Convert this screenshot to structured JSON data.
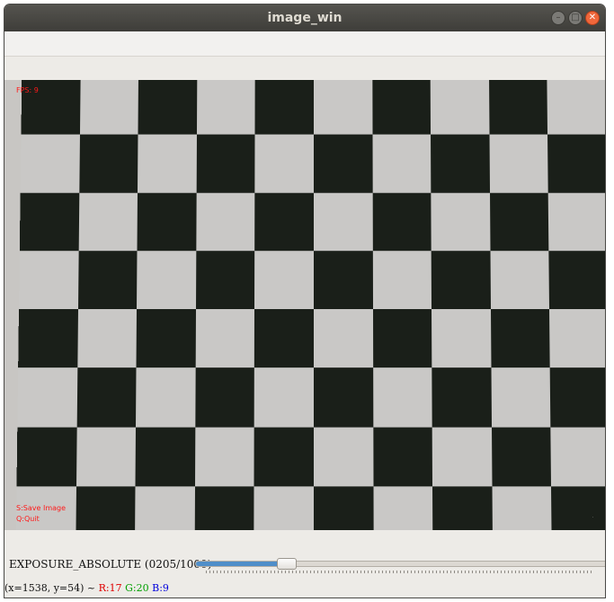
{
  "window": {
    "title": "image_win"
  },
  "overlay": {
    "fps_text": "FPS: 9",
    "save_hint": "S:Save Image",
    "quit_hint": "Q:Quit",
    "text_color": "#ff1a1a"
  },
  "trackbar": {
    "label": "EXPOSURE_ABSOLUTE (0205/1000)",
    "value": 205,
    "max": 1000,
    "fill_color": "#4f8ec9"
  },
  "status": {
    "coords": "(x=1538, y=54) ~",
    "r": "R:17",
    "g": "G:20",
    "b": "B:9",
    "colors": {
      "r": "#e00000",
      "g": "#00a000",
      "b": "#0000dd"
    }
  },
  "pattern": {
    "dark": "#1a1f19",
    "light": "#c9c8c6"
  }
}
